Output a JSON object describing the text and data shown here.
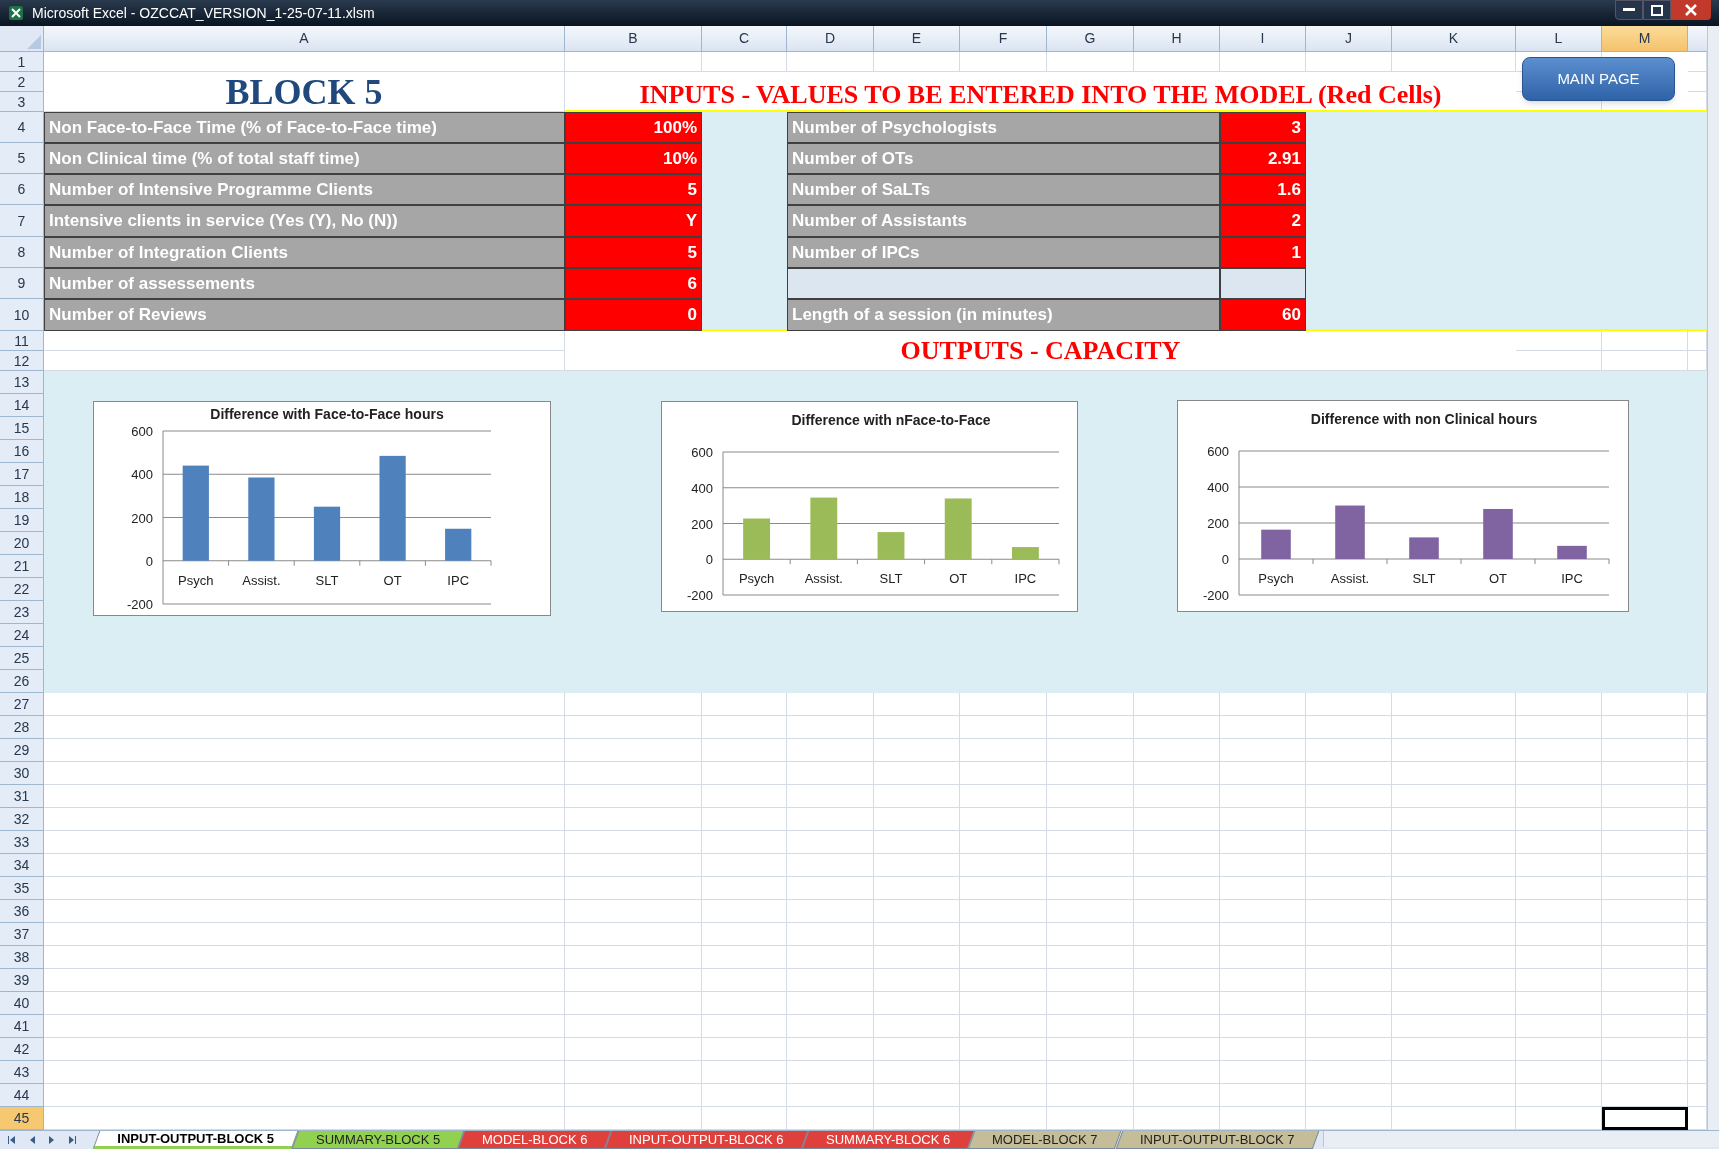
{
  "window": {
    "title": "Microsoft Excel - OZCCAT_VERSION_1-25-07-11.xlsm"
  },
  "columns": [
    {
      "label": "A",
      "selected": false
    },
    {
      "label": "B",
      "selected": false
    },
    {
      "label": "C",
      "selected": false
    },
    {
      "label": "D",
      "selected": false
    },
    {
      "label": "E",
      "selected": false
    },
    {
      "label": "F",
      "selected": false
    },
    {
      "label": "G",
      "selected": false
    },
    {
      "label": "H",
      "selected": false
    },
    {
      "label": "I",
      "selected": false
    },
    {
      "label": "J",
      "selected": false
    },
    {
      "label": "K",
      "selected": false
    },
    {
      "label": "L",
      "selected": false
    },
    {
      "label": "M",
      "selected": true
    }
  ],
  "rows": [
    {
      "label": "1",
      "selected": false
    },
    {
      "label": "2",
      "selected": false
    },
    {
      "label": "3",
      "selected": false
    },
    {
      "label": "4",
      "selected": false
    },
    {
      "label": "5",
      "selected": false
    },
    {
      "label": "6",
      "selected": false
    },
    {
      "label": "7",
      "selected": false
    },
    {
      "label": "8",
      "selected": false
    },
    {
      "label": "9",
      "selected": false
    },
    {
      "label": "10",
      "selected": false
    },
    {
      "label": "11",
      "selected": false
    },
    {
      "label": "12",
      "selected": false
    },
    {
      "label": "13",
      "selected": false
    },
    {
      "label": "14",
      "selected": false
    },
    {
      "label": "15",
      "selected": false
    },
    {
      "label": "16",
      "selected": false
    },
    {
      "label": "17",
      "selected": false
    },
    {
      "label": "18",
      "selected": false
    },
    {
      "label": "19",
      "selected": false
    },
    {
      "label": "20",
      "selected": false
    },
    {
      "label": "21",
      "selected": false
    },
    {
      "label": "22",
      "selected": false
    },
    {
      "label": "23",
      "selected": false
    },
    {
      "label": "24",
      "selected": false
    },
    {
      "label": "25",
      "selected": false
    },
    {
      "label": "26",
      "selected": false
    },
    {
      "label": "27",
      "selected": false
    },
    {
      "label": "28",
      "selected": false
    },
    {
      "label": "29",
      "selected": false
    },
    {
      "label": "30",
      "selected": false
    },
    {
      "label": "31",
      "selected": false
    },
    {
      "label": "32",
      "selected": false
    },
    {
      "label": "33",
      "selected": false
    },
    {
      "label": "34",
      "selected": false
    },
    {
      "label": "35",
      "selected": false
    },
    {
      "label": "36",
      "selected": false
    },
    {
      "label": "37",
      "selected": false
    },
    {
      "label": "38",
      "selected": false
    },
    {
      "label": "39",
      "selected": false
    },
    {
      "label": "40",
      "selected": false
    },
    {
      "label": "41",
      "selected": false
    },
    {
      "label": "42",
      "selected": false
    },
    {
      "label": "43",
      "selected": false
    },
    {
      "label": "44",
      "selected": false
    },
    {
      "label": "45",
      "selected": true
    }
  ],
  "sheet": {
    "block_title": "BLOCK 5",
    "inputs_heading": "INPUTS - VALUES TO BE ENTERED INTO THE MODEL (Red Cells)",
    "main_page_button": "MAIN PAGE",
    "left_inputs": [
      {
        "label": "Non Face-to-Face Time (% of Face-to-Face time)",
        "value": "100%"
      },
      {
        "label": "Non Clinical time (% of total staff time)",
        "value": "10%"
      },
      {
        "label": "Number of Intensive Programme Clients",
        "value": "5"
      },
      {
        "label": "Intensive clients in service (Yes (Y), No (N))",
        "value": "Y"
      },
      {
        "label": "Number of Integration Clients",
        "value": "5"
      },
      {
        "label": "Number of assessements",
        "value": "6"
      },
      {
        "label": "Number of Reviews",
        "value": "0"
      }
    ],
    "right_inputs": [
      {
        "kind": "input",
        "label": "Number of Psychologists",
        "value": "3"
      },
      {
        "kind": "input",
        "label": "Number of OTs",
        "value": "2.91"
      },
      {
        "kind": "input",
        "label": "Number of SaLTs",
        "value": "1.6"
      },
      {
        "kind": "input",
        "label": "Number of Assistants",
        "value": "2"
      },
      {
        "kind": "input",
        "label": "Number of IPCs",
        "value": "1"
      },
      {
        "kind": "blank"
      },
      {
        "kind": "input",
        "label": "Length of a session (in minutes)",
        "value": "60"
      }
    ],
    "outputs_heading": "OUTPUTS - CAPACITY",
    "charts": [
      {
        "chart_data": {
          "type": "bar",
          "title": "Difference with Face-to-Face  hours",
          "categories": [
            "Psych",
            "Assist.",
            "SLT",
            "OT",
            "IPC"
          ],
          "series": [
            {
              "color": "#4f81bd",
              "values": [
                440,
                385,
                250,
                485,
                148
              ]
            }
          ],
          "ylim": [
            -200,
            600
          ],
          "yticks": [
            -200,
            0,
            200,
            400,
            600
          ],
          "grid": true
        }
      },
      {
        "chart_data": {
          "type": "bar",
          "title": "Difference with nFace-to-Face",
          "categories": [
            "Psych",
            "Assist.",
            "SLT",
            "OT",
            "IPC"
          ],
          "series": [
            {
              "color": "#9bbb59",
              "values": [
                228,
                345,
                152,
                340,
                68
              ]
            }
          ],
          "ylim": [
            -200,
            600
          ],
          "yticks": [
            -200,
            0,
            200,
            400,
            600
          ],
          "grid": true
        }
      },
      {
        "chart_data": {
          "type": "bar",
          "title": "Difference with non Clinical  hours",
          "categories": [
            "Psych",
            "Assist.",
            "SLT",
            "OT",
            "IPC"
          ],
          "series": [
            {
              "color": "#8064a2",
              "values": [
                163,
                297,
                120,
                278,
                73
              ]
            }
          ],
          "ylim": [
            -200,
            600
          ],
          "yticks": [
            -200,
            0,
            200,
            400,
            600
          ],
          "grid": true
        }
      }
    ]
  },
  "sheet_tabs": [
    {
      "label": "INPUT-OUTPUT-BLOCK 5",
      "selected": true,
      "color": "#92d050"
    },
    {
      "label": "SUMMARY-BLOCK 5",
      "selected": false,
      "color": "#92d050"
    },
    {
      "label": "MODEL-BLOCK 6",
      "selected": false,
      "color": "#e0403c"
    },
    {
      "label": "INPUT-OUTPUT-BLOCK 6",
      "selected": false,
      "color": "#e0403c"
    },
    {
      "label": "SUMMARY-BLOCK 6",
      "selected": false,
      "color": "#e0403c"
    },
    {
      "label": "MODEL-BLOCK 7",
      "selected": false,
      "color": "#c4bd97"
    },
    {
      "label": "INPUT-OUTPUT-BLOCK 7",
      "selected": false,
      "color": "#c4bd97"
    }
  ]
}
